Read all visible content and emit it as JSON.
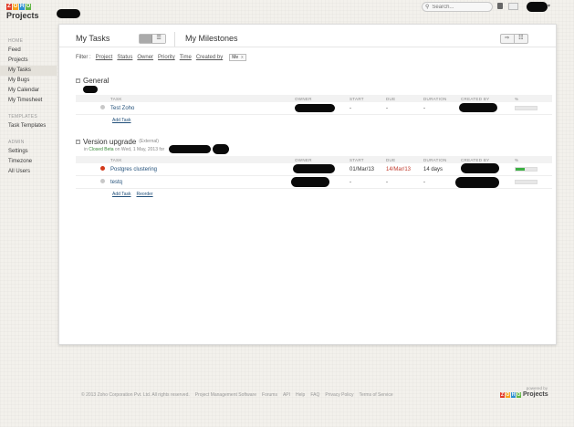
{
  "logo": {
    "letters": [
      "Z",
      "O",
      "H",
      "O"
    ],
    "colors": [
      "#e23c2a",
      "#f6a21e",
      "#2d8fd1",
      "#62b646"
    ],
    "product": "Projects"
  },
  "search": {
    "placeholder": "Search..."
  },
  "sidebar": {
    "sections": [
      {
        "heading": "HOME",
        "items": [
          "Feed",
          "Projects",
          "My Tasks",
          "My Bugs",
          "My Calendar",
          "My Timesheet"
        ]
      },
      {
        "heading": "TEMPLATES",
        "items": [
          "Task Templates"
        ]
      },
      {
        "heading": "ADMIN",
        "items": [
          "Settings",
          "Timezone",
          "All Users"
        ]
      }
    ],
    "active": "My Tasks"
  },
  "tabs": {
    "my_tasks": "My Tasks",
    "my_milestones": "My Milestones"
  },
  "filter": {
    "label": "Filter :",
    "links": [
      "Project",
      "Status",
      "Owner",
      "Priority",
      "Time",
      "Created by"
    ],
    "chip": "Me",
    "chip_close": "x"
  },
  "columns": [
    "TASK",
    "OWNER",
    "START",
    "DUE",
    "DURATION",
    "CREATED BY",
    "%"
  ],
  "sections": [
    {
      "toggle": "−",
      "name": "General",
      "sub": "",
      "meta_prefix": "",
      "tasks": [
        {
          "name": "Test Zoho",
          "status": "grey",
          "start": "-",
          "due": "-",
          "duration": "-",
          "progress": 0
        }
      ],
      "links": [
        "Add Task"
      ]
    },
    {
      "toggle": "−",
      "name": "Version upgrade",
      "sub": "(External)",
      "meta_prefix": "in",
      "meta_milestone": "Closed Beta",
      "meta_date": "on Wed, 1 May, 2013 for",
      "tasks": [
        {
          "name": "Postgres clustering",
          "status": "red",
          "start": "01/Mar/13",
          "due": "14/Mar/13",
          "duration": "14 days",
          "progress": 45
        },
        {
          "name": "testq",
          "status": "grey",
          "start": "-",
          "due": "-",
          "duration": "-",
          "progress": 0
        }
      ],
      "links": [
        "Add Task",
        "Reorder"
      ]
    }
  ],
  "footer": {
    "links": [
      "© 2013 Zoho Corporation Pvt. Ltd. All rights reserved.",
      "Project Management Software",
      "Forums",
      "API",
      "Help",
      "FAQ",
      "Privacy Policy",
      "Terms of Service"
    ],
    "powered_by": "powered by",
    "brand": "Projects"
  }
}
